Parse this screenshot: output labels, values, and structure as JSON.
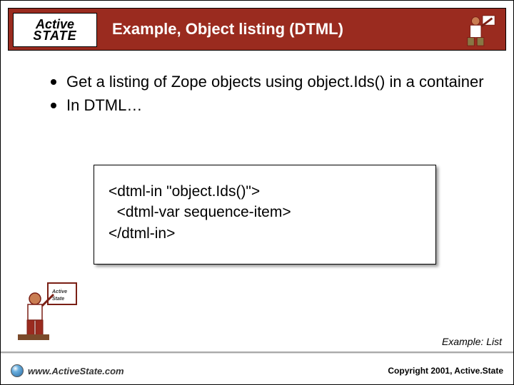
{
  "header": {
    "logo_line1": "Active",
    "logo_line2": "STATE",
    "title": "Example, Object listing (DTML)"
  },
  "bullets": [
    "Get a listing of Zope objects using object.Ids() in a container",
    "In DTML…"
  ],
  "code": {
    "line1": "<dtml-in \"object.Ids()\">",
    "line2": "  <dtml-var sequence-item>",
    "line3": "</dtml-in>"
  },
  "example_label": "Example: List",
  "footer": {
    "url": "www.ActiveState.com",
    "copyright": "Copyright 2001, Active.State"
  }
}
